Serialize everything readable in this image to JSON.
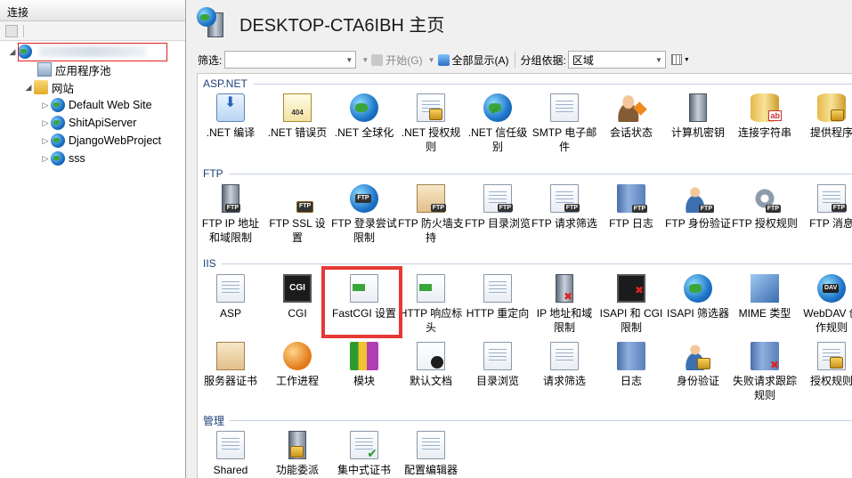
{
  "connections": {
    "header": "连接",
    "tree": [
      {
        "label": "",
        "toggle": "◢",
        "icon": "server-globe-icon",
        "level": 0
      },
      {
        "label": "应用程序池",
        "toggle": "",
        "icon": "app-pool-icon",
        "level": 1
      },
      {
        "label": "网站",
        "toggle": "◢",
        "icon": "sites-folder-icon",
        "level": 1
      },
      {
        "label": "Default Web Site",
        "toggle": "▷",
        "icon": "website-globe-icon",
        "level": 2
      },
      {
        "label": "ShitApiServer",
        "toggle": "▷",
        "icon": "website-globe-icon",
        "level": 2
      },
      {
        "label": "DjangoWebProject",
        "toggle": "▷",
        "icon": "website-globe-icon",
        "level": 2
      },
      {
        "label": "sss",
        "toggle": "▷",
        "icon": "website-globe-icon",
        "level": 2
      }
    ]
  },
  "header": {
    "title": "DESKTOP-CTA6IBH 主页"
  },
  "filterbar": {
    "filter_label": "筛选:",
    "filter_value": "",
    "start_label": "开始(G)",
    "show_all_label": "全部显示(A)",
    "group_by_label": "分组依据:",
    "group_by_value": "区域"
  },
  "groups": [
    {
      "name": "ASP.NET",
      "items": [
        {
          "label": ".NET 编译",
          "icon": "net-compile-icon"
        },
        {
          "label": ".NET 错误页",
          "icon": "net-error-pages-icon"
        },
        {
          "label": ".NET 全球化",
          "icon": "net-globalization-icon"
        },
        {
          "label": ".NET 授权规则",
          "icon": "net-authorization-icon"
        },
        {
          "label": ".NET 信任级别",
          "icon": "net-trust-levels-icon"
        },
        {
          "label": "SMTP 电子邮件",
          "icon": "smtp-email-icon"
        },
        {
          "label": "会话状态",
          "icon": "session-state-icon"
        },
        {
          "label": "计算机密钥",
          "icon": "machine-key-icon"
        },
        {
          "label": "连接字符串",
          "icon": "connection-strings-icon"
        },
        {
          "label": "提供程序",
          "icon": "providers-icon"
        }
      ]
    },
    {
      "name": "FTP",
      "items": [
        {
          "label": "FTP IP 地址和域限制",
          "icon": "ftp-ip-restrictions-icon"
        },
        {
          "label": "FTP SSL 设置",
          "icon": "ftp-ssl-icon"
        },
        {
          "label": "FTP 登录尝试限制",
          "icon": "ftp-logon-attempts-icon"
        },
        {
          "label": "FTP 防火墙支持",
          "icon": "ftp-firewall-icon"
        },
        {
          "label": "FTP 目录浏览",
          "icon": "ftp-directory-browsing-icon"
        },
        {
          "label": "FTP 请求筛选",
          "icon": "ftp-request-filtering-icon"
        },
        {
          "label": "FTP 日志",
          "icon": "ftp-logging-icon"
        },
        {
          "label": "FTP 身份验证",
          "icon": "ftp-authentication-icon"
        },
        {
          "label": "FTP 授权规则",
          "icon": "ftp-authorization-icon"
        },
        {
          "label": "FTP 消息",
          "icon": "ftp-messages-icon"
        }
      ]
    },
    {
      "name": "IIS",
      "items": [
        {
          "label": "ASP",
          "icon": "asp-icon"
        },
        {
          "label": "CGI",
          "icon": "cgi-icon"
        },
        {
          "label": "FastCGI 设置",
          "icon": "fastcgi-icon"
        },
        {
          "label": "HTTP 响应标头",
          "icon": "http-response-headers-icon"
        },
        {
          "label": "HTTP 重定向",
          "icon": "http-redirect-icon"
        },
        {
          "label": "IP 地址和域限制",
          "icon": "ip-restrictions-icon"
        },
        {
          "label": "ISAPI 和 CGI 限制",
          "icon": "isapi-cgi-restrictions-icon"
        },
        {
          "label": "ISAPI 筛选器",
          "icon": "isapi-filters-icon"
        },
        {
          "label": "MIME 类型",
          "icon": "mime-types-icon"
        },
        {
          "label": "WebDAV 创作规则",
          "icon": "webdav-icon"
        },
        {
          "label": "服务器证书",
          "icon": "server-certificates-icon"
        },
        {
          "label": "工作进程",
          "icon": "worker-processes-icon"
        },
        {
          "label": "模块",
          "icon": "modules-icon"
        },
        {
          "label": "默认文档",
          "icon": "default-document-icon"
        },
        {
          "label": "目录浏览",
          "icon": "directory-browsing-icon"
        },
        {
          "label": "请求筛选",
          "icon": "request-filtering-icon"
        },
        {
          "label": "日志",
          "icon": "logging-icon"
        },
        {
          "label": "身份验证",
          "icon": "authentication-icon"
        },
        {
          "label": "失败请求跟踪规则",
          "icon": "failed-request-tracing-icon"
        },
        {
          "label": "授权规则",
          "icon": "authorization-rules-icon"
        }
      ]
    },
    {
      "name": "管理",
      "items": [
        {
          "label": "Shared",
          "icon": "shared-config-icon"
        },
        {
          "label": "功能委派",
          "icon": "feature-delegation-icon"
        },
        {
          "label": "集中式证书",
          "icon": "centralized-certificates-icon"
        },
        {
          "label": "配置编辑器",
          "icon": "configuration-editor-icon"
        }
      ]
    }
  ],
  "highlight_color": "#e53935"
}
